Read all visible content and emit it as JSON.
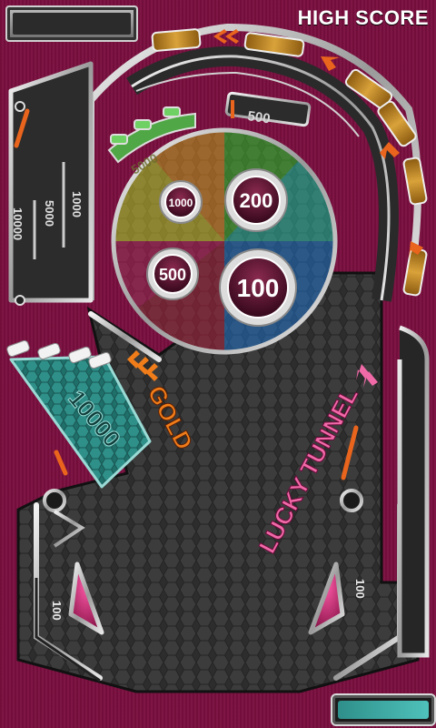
{
  "hud": {
    "high_score_label": "HIGH SCORE"
  },
  "bumpers": {
    "b1000": "1000",
    "b200": "200",
    "b500": "500",
    "b100": "100"
  },
  "labels": {
    "lane_500": "500",
    "lane_5000": "5000",
    "left_1000": "1000",
    "left_5000": "5000",
    "left_10000": "10000",
    "target_10000": "10000",
    "gold": "GOLD",
    "lucky_tunnel": "LUCKY TUNNEL",
    "sling_left_100": "100",
    "sling_right_100": "100"
  },
  "colors": {
    "table_bg": "#7a0f3f",
    "accent_orange": "#e9641c",
    "gold_text": "#f07d1a",
    "pink_text": "#f06aa8",
    "target_teal": "#2e8c86"
  }
}
